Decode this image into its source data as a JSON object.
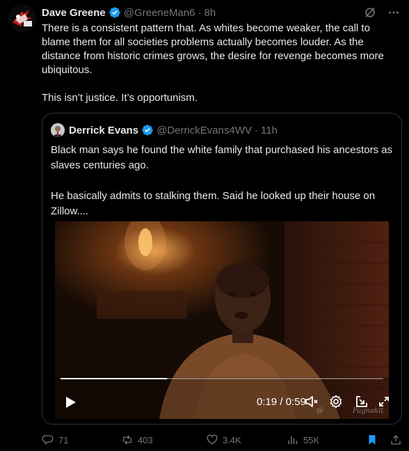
{
  "post": {
    "author_name": "Dave Greene",
    "handle": "@GreeneMan6",
    "separator": "·",
    "time": "8h",
    "paragraph_1": "There is a consistent pattern that. As whites become weaker, the call to blame them for all societies problems actually becomes louder. As the distance from historic crimes grows, the desire for revenge becomes more ubiquitous.",
    "paragraph_2": "This isn’t justice. It’s opportunism."
  },
  "quote": {
    "author_name": "Derrick Evans",
    "handle": "@DerrickEvans4WV",
    "separator": "·",
    "time": "11h",
    "paragraph_1": "Black man says he found the white family that purchased his ancestors as slaves centuries ago.",
    "paragraph_2": "He basically admits to stalking them. Said he looked up their house on Zillow...."
  },
  "video": {
    "current_time": "0:19",
    "time_sep": " / ",
    "duration": "0:59",
    "progress": 0.33,
    "watermark_1": "@",
    "watermark_2": "Pagnakit"
  },
  "actions": {
    "replies": "71",
    "reposts": "403",
    "likes": "3.4K",
    "views": "55K"
  },
  "colors": {
    "background": "#000000",
    "text": "#e7e9ea",
    "muted": "#71767b",
    "verified": "#1d9bf0",
    "bookmark": "#1d9bf0",
    "border": "#2f3336"
  },
  "icons": [
    "verified-badge-icon",
    "grok-icon",
    "more-icon",
    "play-icon",
    "volume-muted-icon",
    "settings-icon",
    "exit-icon",
    "fullscreen-icon",
    "reply-icon",
    "repost-icon",
    "like-icon",
    "views-icon",
    "bookmark-icon",
    "share-icon"
  ]
}
